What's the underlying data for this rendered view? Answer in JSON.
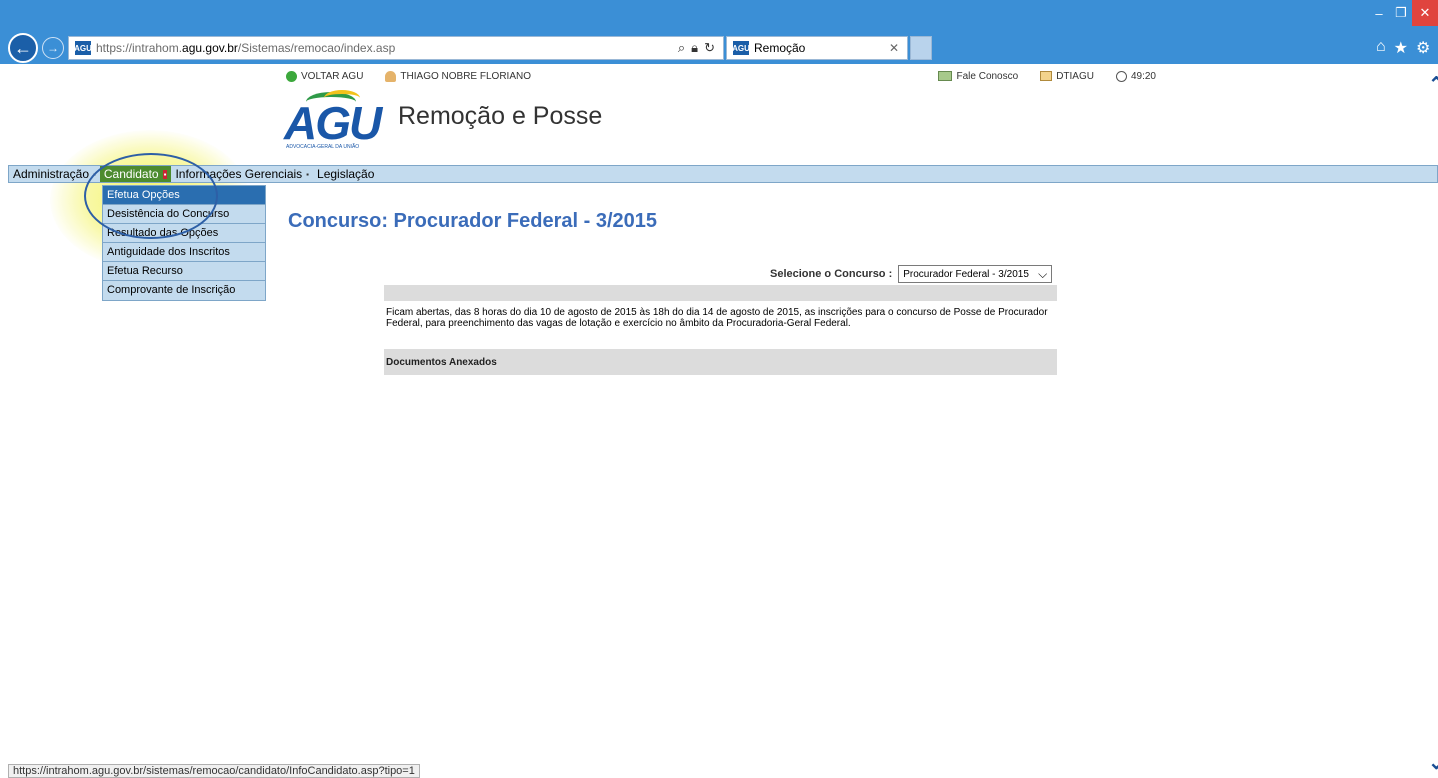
{
  "browser": {
    "url_prefix": "https://intrahom.",
    "url_domain": "agu.gov.br",
    "url_path": "/Sistemas/remocao/index.asp",
    "tab_title": "Remoção",
    "tab_icon_text": "AGU",
    "addr_icon_text": "AGU",
    "status_url": "https://intrahom.agu.gov.br/sistemas/remocao/candidato/InfoCandidato.asp?tipo=1"
  },
  "topbar": {
    "voltar": "VOLTAR AGU",
    "user": "THIAGO NOBRE FLORIANO",
    "fale": "Fale Conosco",
    "dtiagu": "DTIAGU",
    "timer": "49:20"
  },
  "header": {
    "logo_text": "AGU",
    "logo_sub": "ADVOCACIA-GERAL DA UNIÃO",
    "app_title": "Remoção e Posse"
  },
  "menu": {
    "items": [
      {
        "label": "Administração"
      },
      {
        "label": "Candidato"
      },
      {
        "label": "Informações Gerenciais"
      },
      {
        "label": "Legislação"
      }
    ],
    "dropdown": [
      {
        "label": "Efetua Opções"
      },
      {
        "label": "Desistência do Concurso"
      },
      {
        "label": "Resultado das Opções"
      },
      {
        "label": "Antiguidade dos Inscritos"
      },
      {
        "label": "Efetua Recurso"
      },
      {
        "label": "Comprovante de Inscrição"
      }
    ]
  },
  "main": {
    "heading": "Concurso: Procurador Federal - 3/2015",
    "select_label": "Selecione o Concurso :",
    "select_value": "Procurador Federal - 3/2015",
    "notice": "Ficam abertas, das 8 horas do dia 10 de agosto de 2015 às 18h do dia 14 de agosto de 2015, as inscrições para o concurso de Posse de Procurador Federal, para preenchimento das vagas de lotação e exercício no âmbito da Procuradoria-Geral Federal.",
    "docs_label": "Documentos Anexados"
  },
  "colors": {
    "chrome": "#3b8fd6",
    "menubar": "#c3dbee",
    "active_menu": "#4d8b2f",
    "heading": "#3b6cb9"
  }
}
